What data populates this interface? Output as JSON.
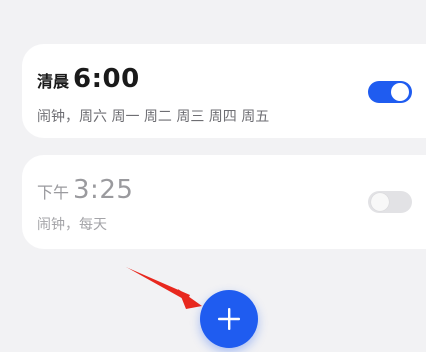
{
  "alarms": [
    {
      "period": "清晨",
      "time": "6:00",
      "subtitle": "闹钟，周六 周一 周二 周三 周四 周五",
      "enabled": true
    },
    {
      "period": "下午",
      "time": "3:25",
      "subtitle": "闹钟，每天",
      "enabled": false
    }
  ],
  "colors": {
    "accent": "#1f5cf0",
    "background": "#f2f2f4",
    "card": "#ffffff",
    "annotation_arrow": "#e8281e"
  },
  "icons": {
    "add": "plus-icon",
    "annotation": "red-arrow-icon"
  }
}
